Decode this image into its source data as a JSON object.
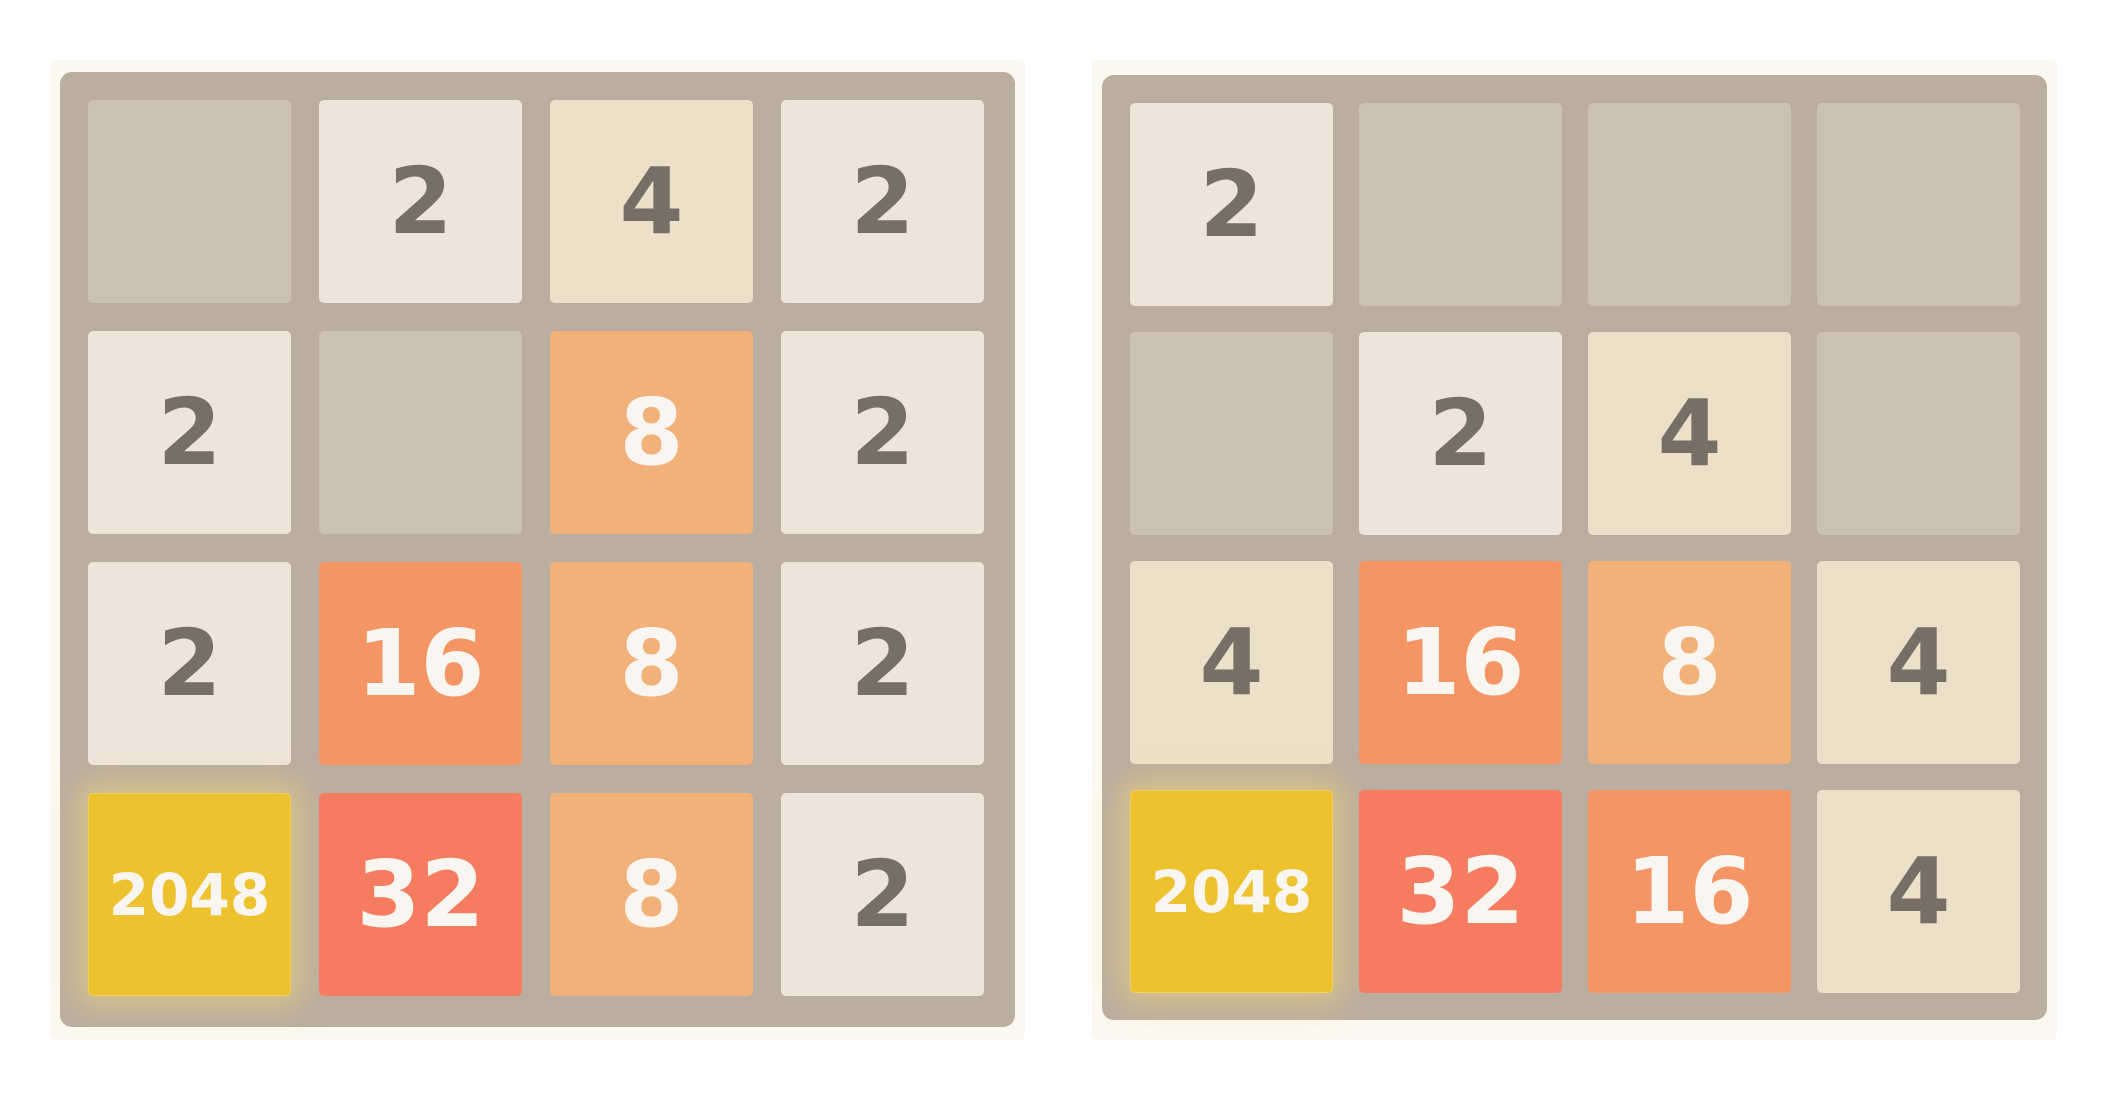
{
  "boards": [
    {
      "name": "left",
      "tiles": [
        [
          "",
          "2",
          "4",
          "2"
        ],
        [
          "2",
          "",
          "8",
          "2"
        ],
        [
          "2",
          "16",
          "8",
          "2"
        ],
        [
          "2048",
          "32",
          "8",
          "2"
        ]
      ]
    },
    {
      "name": "right",
      "tiles": [
        [
          "2",
          "",
          "",
          ""
        ],
        [
          "",
          "2",
          "4",
          ""
        ],
        [
          "4",
          "16",
          "8",
          "4"
        ],
        [
          "2048",
          "32",
          "16",
          "4"
        ]
      ]
    }
  ],
  "colors": {
    "board_background": "#bbada0",
    "empty_cell": "#cdc1b4",
    "tile_2": "#eee4da",
    "tile_4": "#ede0c8",
    "tile_8": "#f2b179",
    "tile_16": "#f59563",
    "tile_32": "#f67c5f",
    "tile_2048": "#edc22e",
    "dark_text": "#776e65",
    "light_text": "#f9f6f2"
  }
}
